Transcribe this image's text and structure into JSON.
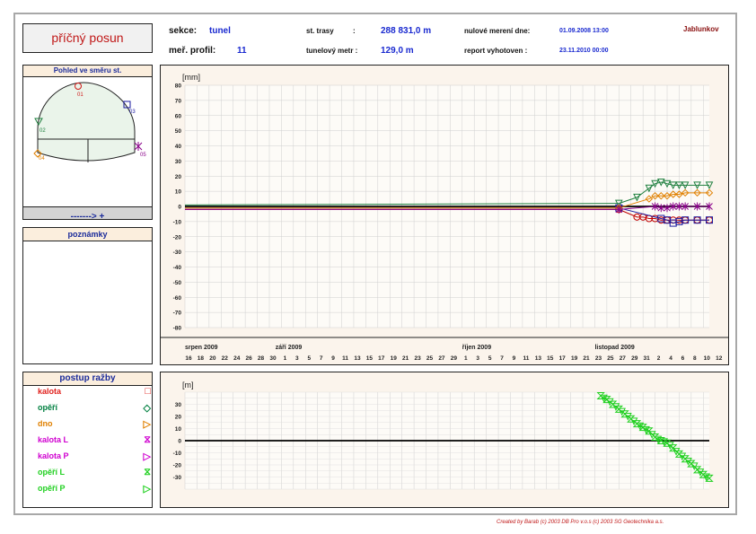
{
  "title": "příčný posun",
  "header": {
    "sekce_label": "sekce:",
    "sekce_value": "tunel",
    "profil_label": "meř. profil:",
    "profil_value": "11",
    "trasa_label": "st. trasy",
    "trasa_colon": ":",
    "trasa_value": "288  831,0 m",
    "tunel_label": "tunelový metr :",
    "tunel_value": "129,0 m",
    "nulove_label": "nulové merení dne:",
    "nulove_value": "01.09.2008 13:00",
    "report_label": "report vyhotoven :",
    "report_value": "23.11.2010 00:00",
    "site": "Jablunkov"
  },
  "view_panel": {
    "title": "Pohled ve směru st.",
    "arrow": "-------> +",
    "points": [
      "01",
      "02",
      "03",
      "04",
      "05"
    ]
  },
  "notes_panel": {
    "title": "poznámky"
  },
  "legend": {
    "title": "postup ražby",
    "items": [
      {
        "label": "kalota",
        "color": "#e0201c",
        "symbol": "□"
      },
      {
        "label": "opěří",
        "color": "#008040",
        "symbol": "◇"
      },
      {
        "label": "dno",
        "color": "#e08000",
        "symbol": "▷"
      },
      {
        "label": "kalota L",
        "color": "#d000d0",
        "symbol": "⧖"
      },
      {
        "label": "kalota P",
        "color": "#d000d0",
        "symbol": "▷"
      },
      {
        "label": "opěří L",
        "color": "#20d020",
        "symbol": "⧖"
      },
      {
        "label": "opěří P",
        "color": "#20d020",
        "symbol": "▷"
      }
    ]
  },
  "footer": "Created by Barab (c) 2003 DB Pro v.o.s (c) 2003 SG Geotechnika a.s.",
  "chart_data": [
    {
      "type": "line",
      "ylabel": "[mm]",
      "ylim": [
        -80,
        80
      ],
      "yticks": [
        80,
        70,
        60,
        50,
        40,
        30,
        20,
        10,
        0,
        -10,
        -20,
        -30,
        -40,
        -50,
        -60,
        -70,
        -80
      ],
      "grid": true,
      "months": [
        {
          "label": "srpen 2009",
          "at": 16
        },
        {
          "label": "září 2009",
          "at": 31
        },
        {
          "label": "říjen 2009",
          "at": 62
        },
        {
          "label": "listopad 2009",
          "at": 84
        }
      ],
      "day_labels": [
        "16",
        "18",
        "20",
        "22",
        "24",
        "26",
        "28",
        "30",
        "1",
        "3",
        "5",
        "7",
        "9",
        "11",
        "13",
        "15",
        "17",
        "19",
        "21",
        "23",
        "25",
        "27",
        "29",
        "1",
        "3",
        "5",
        "7",
        "9",
        "11",
        "13",
        "15",
        "17",
        "19",
        "21",
        "23",
        "25",
        "27",
        "29",
        "31",
        "2",
        "4",
        "6",
        "8",
        "10",
        "12"
      ],
      "x_start": 16,
      "x_end": 103,
      "series": [
        {
          "name": "01",
          "color": "#c00000",
          "marker": "circle",
          "baseline": -2,
          "x": [
            88,
            91,
            92,
            93,
            94,
            95,
            96,
            97,
            98,
            99,
            101,
            103
          ],
          "y": [
            -2,
            -7,
            -7,
            -8,
            -8,
            -9,
            -9,
            -9,
            -9,
            -9,
            -9,
            -9
          ]
        },
        {
          "name": "02",
          "color": "#208040",
          "marker": "triangle",
          "baseline": 1,
          "x": [
            88,
            91,
            93,
            94,
            95,
            96,
            97,
            98,
            99,
            101,
            103
          ],
          "y": [
            2,
            6,
            12,
            15,
            16,
            15,
            14,
            14,
            14,
            14,
            14
          ]
        },
        {
          "name": "03",
          "color": "#1a1aa0",
          "marker": "square",
          "baseline": -1,
          "x": [
            88,
            95,
            96,
            97,
            98,
            99,
            101,
            103
          ],
          "y": [
            -1,
            -8,
            -9,
            -11,
            -10,
            -9,
            -9,
            -9
          ]
        },
        {
          "name": "04",
          "color": "#e08000",
          "marker": "diamond",
          "baseline": -1,
          "x": [
            88,
            93,
            94,
            95,
            96,
            97,
            98,
            99,
            101,
            103
          ],
          "y": [
            -1,
            5,
            7,
            7,
            7,
            8,
            8,
            9,
            9,
            9
          ]
        },
        {
          "name": "05",
          "color": "#8a008a",
          "marker": "star",
          "baseline": -2,
          "x": [
            88,
            94,
            95,
            96,
            97,
            98,
            99,
            101,
            103
          ],
          "y": [
            -2,
            0,
            -1,
            -1,
            0,
            0,
            0,
            0,
            0
          ]
        }
      ]
    },
    {
      "type": "scatter",
      "ylabel": "[m]",
      "ylim": [
        -40,
        40
      ],
      "yticks": [
        30,
        20,
        10,
        0,
        -10,
        -20,
        -30
      ],
      "grid": true,
      "x_start": 16,
      "x_end": 103,
      "series": [
        {
          "name": "opěří L",
          "color": "#20d020",
          "x": [
            85,
            86,
            87,
            88,
            89,
            90,
            91,
            92,
            93,
            94,
            95,
            96,
            97,
            98,
            99,
            100,
            101,
            102,
            103
          ],
          "y": [
            37,
            34,
            30,
            26,
            22,
            18,
            14,
            11,
            8,
            3,
            0,
            -2,
            -6,
            -11,
            -15,
            -19,
            -24,
            -28,
            -31
          ]
        },
        {
          "name": "opěří P",
          "color": "#20d020",
          "x": [
            85.5,
            86.5,
            87.5,
            88.5,
            89.5,
            90.5,
            91.5,
            92.5,
            93.5,
            94.5,
            95.5,
            96.5,
            97.5,
            98.5,
            99.5,
            100.5,
            101.5,
            102.5
          ],
          "y": [
            35,
            32,
            28,
            24,
            20,
            16,
            12,
            9,
            5,
            1,
            -1,
            -4,
            -9,
            -13,
            -17,
            -21,
            -26,
            -30
          ]
        }
      ]
    }
  ]
}
